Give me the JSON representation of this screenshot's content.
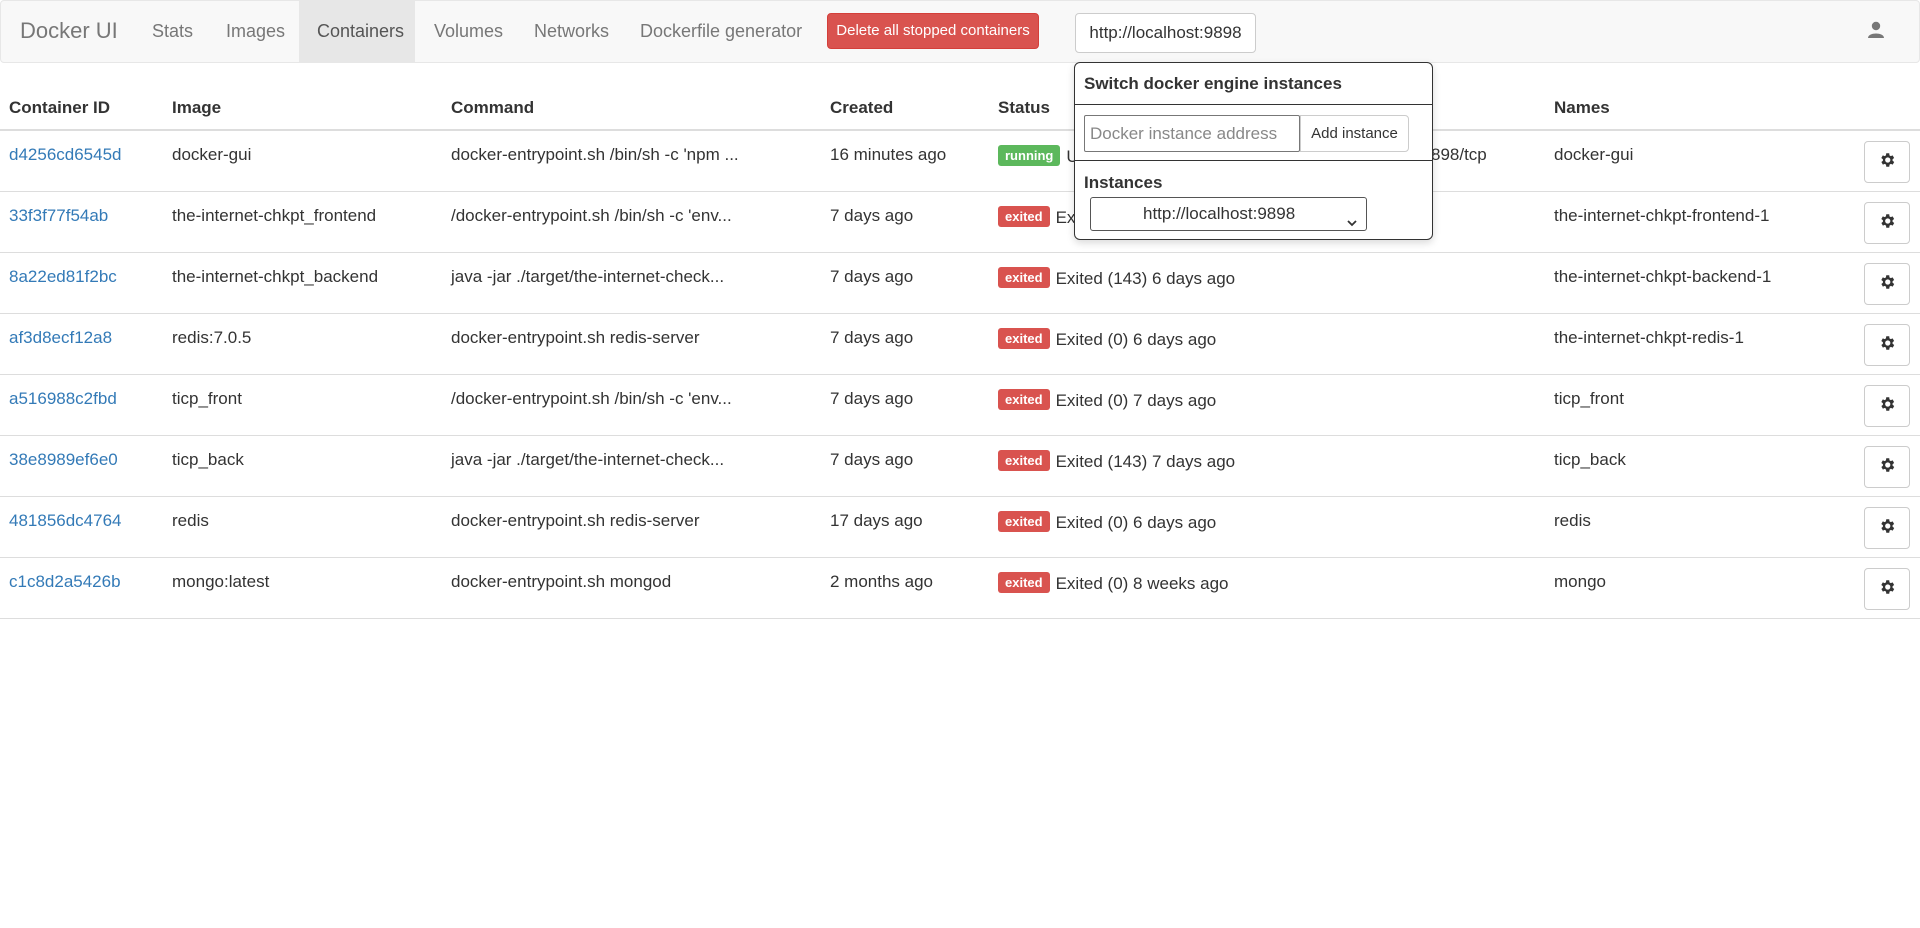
{
  "nav": {
    "brand": "Docker UI",
    "links": [
      {
        "label": "Stats"
      },
      {
        "label": "Images"
      },
      {
        "label": "Containers",
        "active": true
      },
      {
        "label": "Volumes"
      },
      {
        "label": "Networks"
      },
      {
        "label": "Dockerfile generator"
      }
    ],
    "delete_button": "Delete all stopped containers",
    "host_button": "http://localhost:9898",
    "user_icon": "user-icon"
  },
  "table": {
    "headers": {
      "id": "Container ID",
      "image": "Image",
      "command": "Command",
      "created": "Created",
      "status": "Status",
      "names": "Names"
    },
    "rows": [
      {
        "id": "d4256cd6545d",
        "image": "docker-gui",
        "command": "docker-entrypoint.sh /bin/sh -c 'npm ...",
        "created": "16 minutes ago",
        "badge": "running",
        "status": "Up",
        "ports": "898/tcp",
        "names": "docker-gui"
      },
      {
        "id": "33f3f77f54ab",
        "image": "the-internet-chkpt_frontend",
        "command": "/docker-entrypoint.sh /bin/sh -c 'env...",
        "created": "7 days ago",
        "badge": "exited",
        "status": "Exit",
        "ports": "",
        "names": "the-internet-chkpt-frontend-1"
      },
      {
        "id": "8a22ed81f2bc",
        "image": "the-internet-chkpt_backend",
        "command": "java -jar ./target/the-internet-check...",
        "created": "7 days ago",
        "badge": "exited",
        "status": "Exited (143) 6 days ago",
        "ports": "",
        "names": "the-internet-chkpt-backend-1"
      },
      {
        "id": "af3d8ecf12a8",
        "image": "redis:7.0.5",
        "command": "docker-entrypoint.sh redis-server",
        "created": "7 days ago",
        "badge": "exited",
        "status": "Exited (0) 6 days ago",
        "ports": "",
        "names": "the-internet-chkpt-redis-1"
      },
      {
        "id": "a516988c2fbd",
        "image": "ticp_front",
        "command": "/docker-entrypoint.sh /bin/sh -c 'env...",
        "created": "7 days ago",
        "badge": "exited",
        "status": "Exited (0) 7 days ago",
        "ports": "",
        "names": "ticp_front"
      },
      {
        "id": "38e8989ef6e0",
        "image": "ticp_back",
        "command": "java -jar ./target/the-internet-check...",
        "created": "7 days ago",
        "badge": "exited",
        "status": "Exited (143) 7 days ago",
        "ports": "",
        "names": "ticp_back"
      },
      {
        "id": "481856dc4764",
        "image": "redis",
        "command": "docker-entrypoint.sh redis-server",
        "created": "17 days ago",
        "badge": "exited",
        "status": "Exited (0) 6 days ago",
        "ports": "",
        "names": "redis"
      },
      {
        "id": "c1c8d2a5426b",
        "image": "mongo:latest",
        "command": "docker-entrypoint.sh mongod",
        "created": "2 months ago",
        "badge": "exited",
        "status": "Exited (0) 8 weeks ago",
        "ports": "",
        "names": "mongo"
      }
    ],
    "action_icon": "gear-icon"
  },
  "popover": {
    "title": "Switch docker engine instances",
    "input_placeholder": "Docker instance address",
    "add_button": "Add instance",
    "instances_label": "Instances",
    "selected_instance": "http://localhost:9898"
  }
}
